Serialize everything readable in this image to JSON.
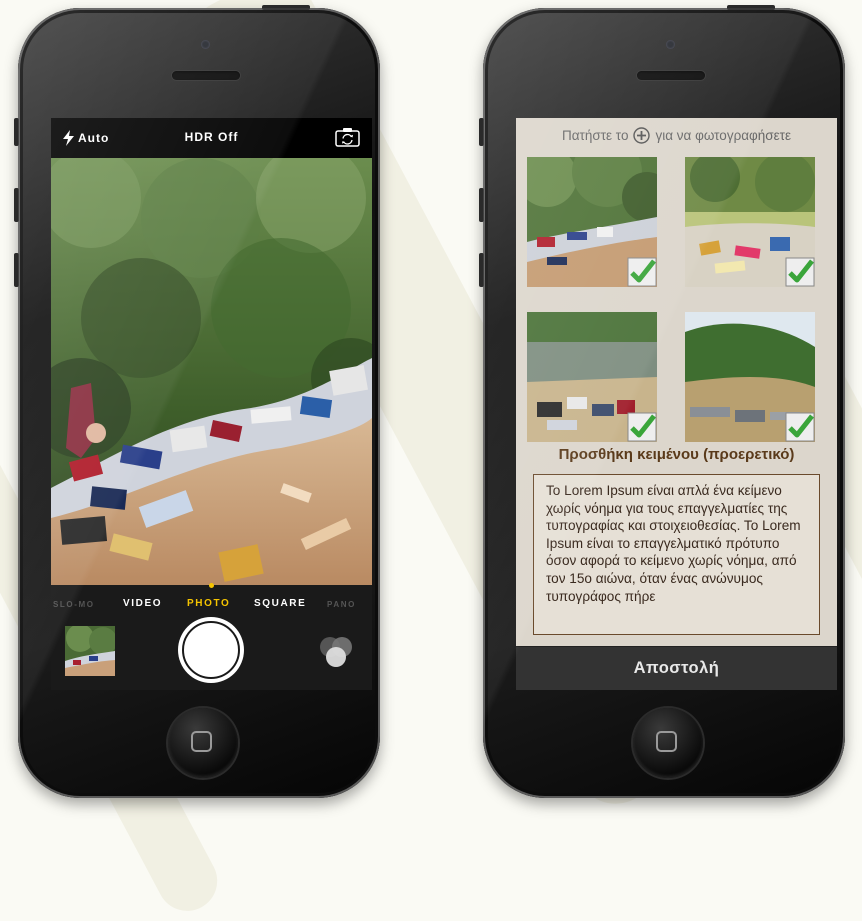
{
  "camera": {
    "flash_label": "Auto",
    "hdr_label": "HDR Off",
    "modes": {
      "slomo": "SLO-MO",
      "video": "VIDEO",
      "photo": "PHOTO",
      "square": "SQUARE",
      "pano": "PANO"
    },
    "active_mode": "PHOTO",
    "accent_color": "#f5c400",
    "icons": [
      "flash-icon",
      "flip-camera-icon",
      "shutter-button",
      "filters-icon"
    ]
  },
  "app": {
    "hint": {
      "before": "Πατήστε το",
      "after": "για να φωτογραφήσετε",
      "icon": "plus-circle-icon"
    },
    "photos": [
      {
        "checked": true
      },
      {
        "checked": true
      },
      {
        "checked": true
      },
      {
        "checked": true
      }
    ],
    "section_title": "Προσθήκη κειμένου (προερετικό)",
    "text_content": "Το Lorem Ipsum είναι απλά ένα κείμενο χωρίς νόημα για τους επαγγελματίες της τυπογραφίας και στοιχειοθεσίας. Το Lorem Ipsum είναι το επαγγελματικό πρότυπο όσον αφορά το κείμενο χωρίς νόημα, από τον 15ο αιώνα, όταν ένας ανώνυμος τυπογράφος πήρε",
    "send_button": "Αποστολή",
    "colors": {
      "background": "#dcd6cc",
      "title": "#5a3a1a",
      "check": "#3aa53a"
    }
  }
}
